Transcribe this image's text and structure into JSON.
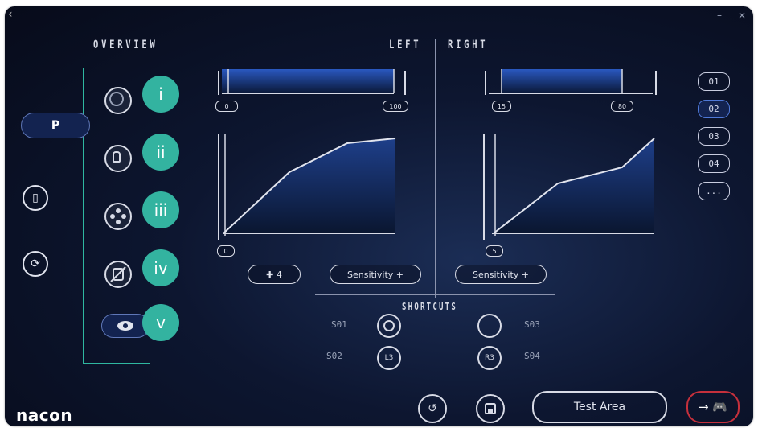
{
  "window": {
    "back_glyph": "‹",
    "minimize_glyph": "–",
    "close_glyph": "×"
  },
  "overview": {
    "title": "OVERVIEW",
    "modes": [
      {
        "icon": "stick-icon",
        "badge": "i"
      },
      {
        "icon": "trigger-icon",
        "badge": "ii"
      },
      {
        "icon": "buttons-icon",
        "badge": "iii"
      },
      {
        "icon": "vibration-off-icon",
        "badge": "iv"
      },
      {
        "icon": "eye-icon",
        "badge": "v"
      }
    ]
  },
  "sidebar": {
    "platform_icon": "playstation-icon",
    "items": [
      "device-icon",
      "sync-icon"
    ]
  },
  "header": {
    "left": "LEFT",
    "right": "RIGHT"
  },
  "left_stick": {
    "range_min_label": "0",
    "range_max_label": "100",
    "deadzone_label": "0",
    "curve_label": "✚ 4",
    "sensitivity_label": "Sensitivity +"
  },
  "right_stick": {
    "range_min_label": "15",
    "range_max_label": "80",
    "deadzone_label": "5",
    "sensitivity_label": "Sensitivity +"
  },
  "profiles": [
    "01",
    "02",
    "03",
    "04",
    "..."
  ],
  "profile_active_index": 1,
  "shortcuts": {
    "title": "SHORTCUTS",
    "items": [
      {
        "label": "S01",
        "button": ""
      },
      {
        "label": "S02",
        "button": "L3"
      },
      {
        "label": "S03",
        "button": ""
      },
      {
        "label": "S04",
        "button": "R3"
      }
    ]
  },
  "bottom": {
    "test_area": "Test Area",
    "exit_glyph": "→ 🎮"
  },
  "brand": {
    "logo": "nacon"
  },
  "colors": {
    "accent_teal": "#33b3a0",
    "accent_blue": "#1f4aa8",
    "exit_red": "#c5303c"
  }
}
